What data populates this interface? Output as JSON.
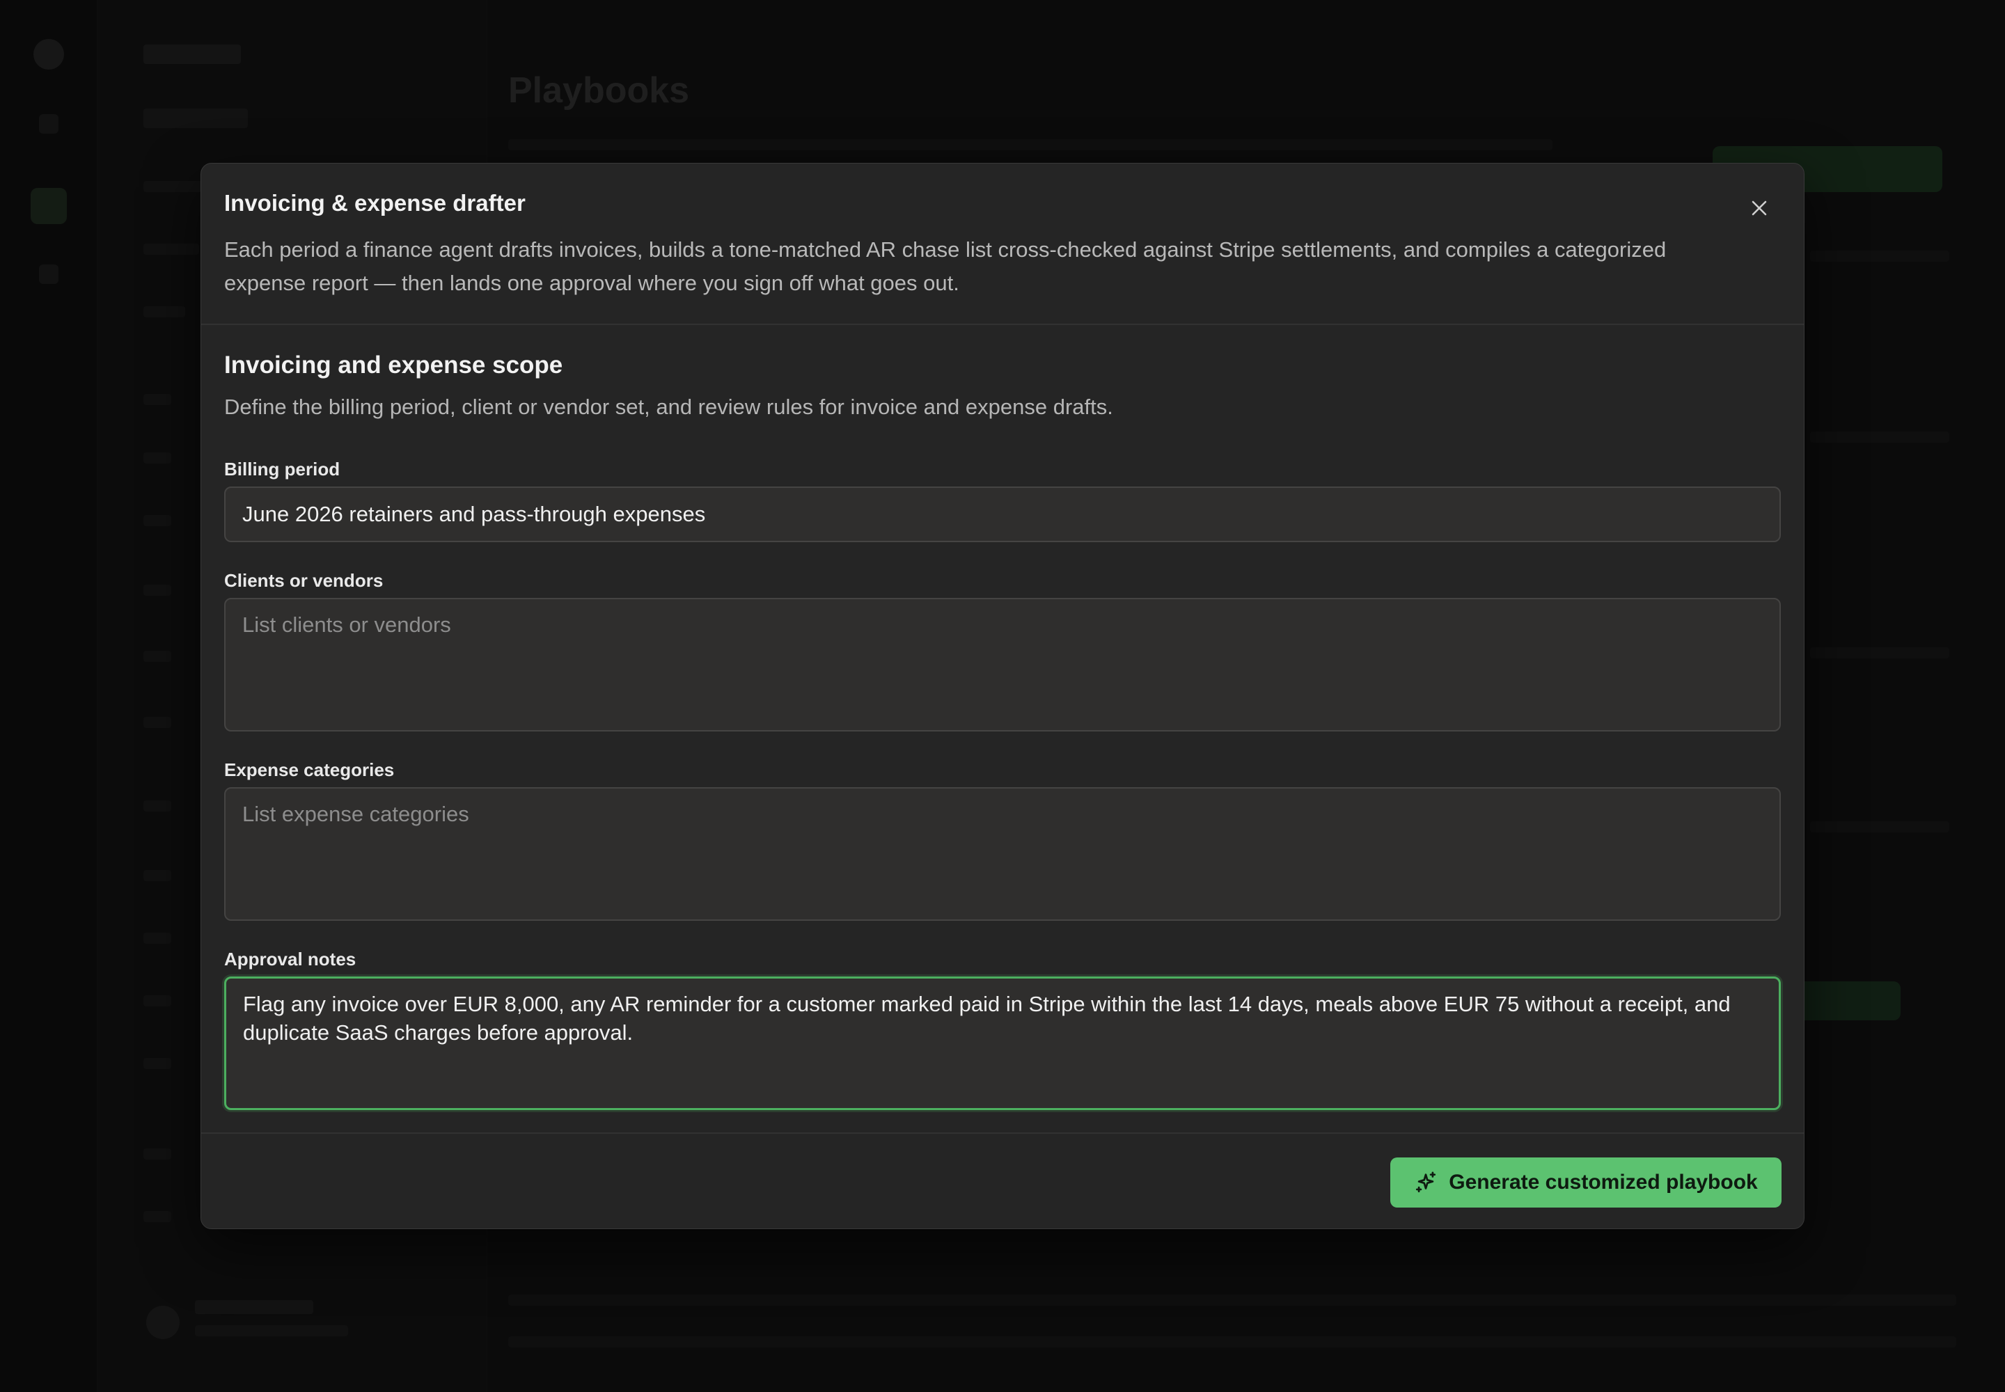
{
  "background": {
    "page_title": "Playbooks"
  },
  "modal": {
    "title": "Invoicing & expense drafter",
    "description": "Each period a finance agent drafts invoices, builds a tone-matched AR chase list cross-checked against Stripe settlements, and compiles a categorized expense report — then lands one approval where you sign off what goes out.",
    "close_icon": "close-icon",
    "section": {
      "title": "Invoicing and expense scope",
      "description": "Define the billing period, client or vendor set, and review rules for invoice and expense drafts."
    },
    "fields": {
      "billing_period": {
        "label": "Billing period",
        "value": "June 2026 retainers and pass-through expenses"
      },
      "clients_vendors": {
        "label": "Clients or vendors",
        "value": "",
        "placeholder": "List clients or vendors"
      },
      "expense_categories": {
        "label": "Expense categories",
        "value": "",
        "placeholder": "List expense categories"
      },
      "approval_notes": {
        "label": "Approval notes",
        "value": "Flag any invoice over EUR 8,000, any AR reminder for a customer marked paid in Stripe within the last 14 days, meals above EUR 75 without a receipt, and duplicate SaaS charges before approval."
      }
    },
    "primary_button": {
      "label": "Generate customized playbook",
      "icon": "sparkles-icon"
    }
  },
  "colors": {
    "accent": "#5cc270",
    "focus_ring": "#4caf5f",
    "modal_bg": "#252525",
    "input_bg": "#2f2e2d"
  }
}
